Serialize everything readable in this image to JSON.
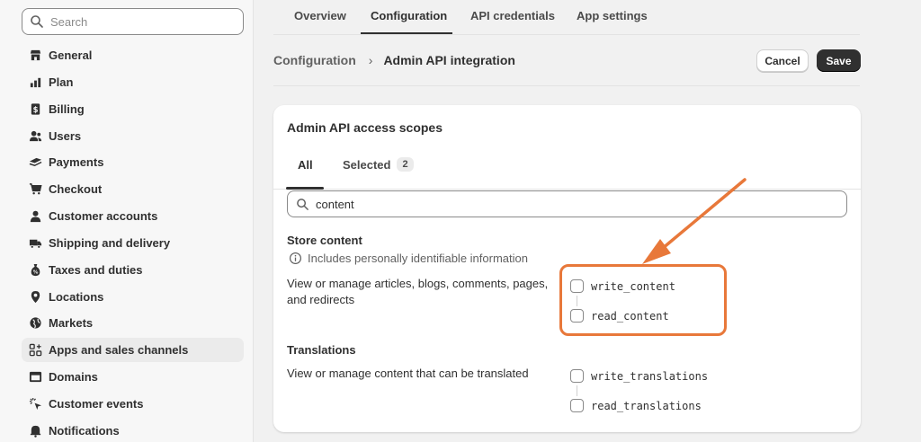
{
  "sidebar": {
    "search_placeholder": "Search",
    "items": [
      {
        "label": "General",
        "icon": "store-icon"
      },
      {
        "label": "Plan",
        "icon": "plan-icon"
      },
      {
        "label": "Billing",
        "icon": "billing-icon"
      },
      {
        "label": "Users",
        "icon": "users-icon"
      },
      {
        "label": "Payments",
        "icon": "payments-icon"
      },
      {
        "label": "Checkout",
        "icon": "cart-icon"
      },
      {
        "label": "Customer accounts",
        "icon": "person-icon"
      },
      {
        "label": "Shipping and delivery",
        "icon": "truck-icon"
      },
      {
        "label": "Taxes and duties",
        "icon": "tax-icon"
      },
      {
        "label": "Locations",
        "icon": "location-pin-icon"
      },
      {
        "label": "Markets",
        "icon": "globe-icon"
      },
      {
        "label": "Apps and sales channels",
        "icon": "apps-icon",
        "active": true
      },
      {
        "label": "Domains",
        "icon": "domains-icon"
      },
      {
        "label": "Customer events",
        "icon": "cursor-click-icon"
      },
      {
        "label": "Notifications",
        "icon": "bell-icon"
      }
    ]
  },
  "tabs": [
    "Overview",
    "Configuration",
    "API credentials",
    "App settings"
  ],
  "active_tab": "Configuration",
  "breadcrumb": {
    "parent": "Configuration",
    "separator": "›",
    "current": "Admin API integration"
  },
  "actions": {
    "cancel": "Cancel",
    "save": "Save"
  },
  "card": {
    "title": "Admin API access scopes",
    "tabs": {
      "all": "All",
      "selected": "Selected",
      "selected_count": "2"
    },
    "filter_value": "content",
    "sections": [
      {
        "title": "Store content",
        "note": "Includes personally identifiable information",
        "description": "View or manage articles, blogs, comments, pages, and redirects",
        "scopes": [
          "write_content",
          "read_content"
        ]
      },
      {
        "title": "Translations",
        "description": "View or manage content that can be translated",
        "scopes": [
          "write_translations",
          "read_translations"
        ]
      }
    ]
  },
  "colors": {
    "accent_annotation": "#e8783a",
    "primary_button": "#303030"
  }
}
